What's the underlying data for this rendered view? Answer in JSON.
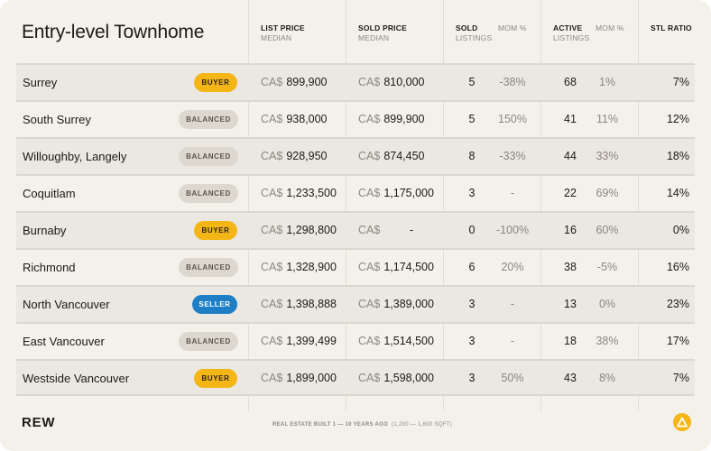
{
  "title": "Entry-level Townhome",
  "columns": {
    "list_price": {
      "line1": "LIST PRICE",
      "line2": "MEDIAN"
    },
    "sold_price": {
      "line1": "SOLD PRICE",
      "line2": "MEDIAN"
    },
    "sold_listings": {
      "line1": "SOLD",
      "line2": "LISTINGS"
    },
    "sold_mom": {
      "line1": "MOM %"
    },
    "active_listings": {
      "line1": "ACTIVE",
      "line2": "LISTINGS"
    },
    "active_mom": {
      "line1": "MOM %"
    },
    "stl": {
      "line1": "STL RATIO"
    }
  },
  "currency": "CA$",
  "rows": [
    {
      "area": "Surrey",
      "market": "BUYER",
      "market_type": "buyer",
      "list_price": "899,900",
      "sold_price": "810,000",
      "sold": "5",
      "sold_mom": "-38%",
      "active": "68",
      "active_mom": "1%",
      "stl": "7%"
    },
    {
      "area": "South Surrey",
      "market": "BALANCED",
      "market_type": "balanced",
      "list_price": "938,000",
      "sold_price": "899,900",
      "sold": "5",
      "sold_mom": "150%",
      "active": "41",
      "active_mom": "11%",
      "stl": "12%"
    },
    {
      "area": "Willoughby, Langely",
      "market": "BALANCED",
      "market_type": "balanced",
      "list_price": "928,950",
      "sold_price": "874,450",
      "sold": "8",
      "sold_mom": "-33%",
      "active": "44",
      "active_mom": "33%",
      "stl": "18%"
    },
    {
      "area": "Coquitlam",
      "market": "BALANCED",
      "market_type": "balanced",
      "list_price": "1,233,500",
      "sold_price": "1,175,000",
      "sold": "3",
      "sold_mom": "-",
      "active": "22",
      "active_mom": "69%",
      "stl": "14%"
    },
    {
      "area": "Burnaby",
      "market": "BUYER",
      "market_type": "buyer",
      "list_price": "1,298,800",
      "sold_price": "-",
      "sold": "0",
      "sold_mom": "-100%",
      "active": "16",
      "active_mom": "60%",
      "stl": "0%"
    },
    {
      "area": "Richmond",
      "market": "BALANCED",
      "market_type": "balanced",
      "list_price": "1,328,900",
      "sold_price": "1,174,500",
      "sold": "6",
      "sold_mom": "20%",
      "active": "38",
      "active_mom": "-5%",
      "stl": "16%"
    },
    {
      "area": "North Vancouver",
      "market": "SELLER",
      "market_type": "seller",
      "list_price": "1,398,888",
      "sold_price": "1,389,000",
      "sold": "3",
      "sold_mom": "-",
      "active": "13",
      "active_mom": "0%",
      "stl": "23%"
    },
    {
      "area": "East Vancouver",
      "market": "BALANCED",
      "market_type": "balanced",
      "list_price": "1,399,499",
      "sold_price": "1,514,500",
      "sold": "3",
      "sold_mom": "-",
      "active": "18",
      "active_mom": "38%",
      "stl": "17%"
    },
    {
      "area": "Westside Vancouver",
      "market": "BUYER",
      "market_type": "buyer",
      "list_price": "1,899,000",
      "sold_price": "1,598,000",
      "sold": "3",
      "sold_mom": "50%",
      "active": "43",
      "active_mom": "8%",
      "stl": "7%"
    }
  ],
  "footer": {
    "logo": "REW",
    "note_main": "REAL ESTATE BUILT 1 — 10 YEARS AGO",
    "note_sub": "(1,200 — 1,600 SQFT)"
  },
  "colors": {
    "buyer": "#f4b617",
    "balanced": "#dcd8d0",
    "seller": "#1f7fc6"
  },
  "icons": {
    "footer_right": "warning-triangle-icon"
  }
}
